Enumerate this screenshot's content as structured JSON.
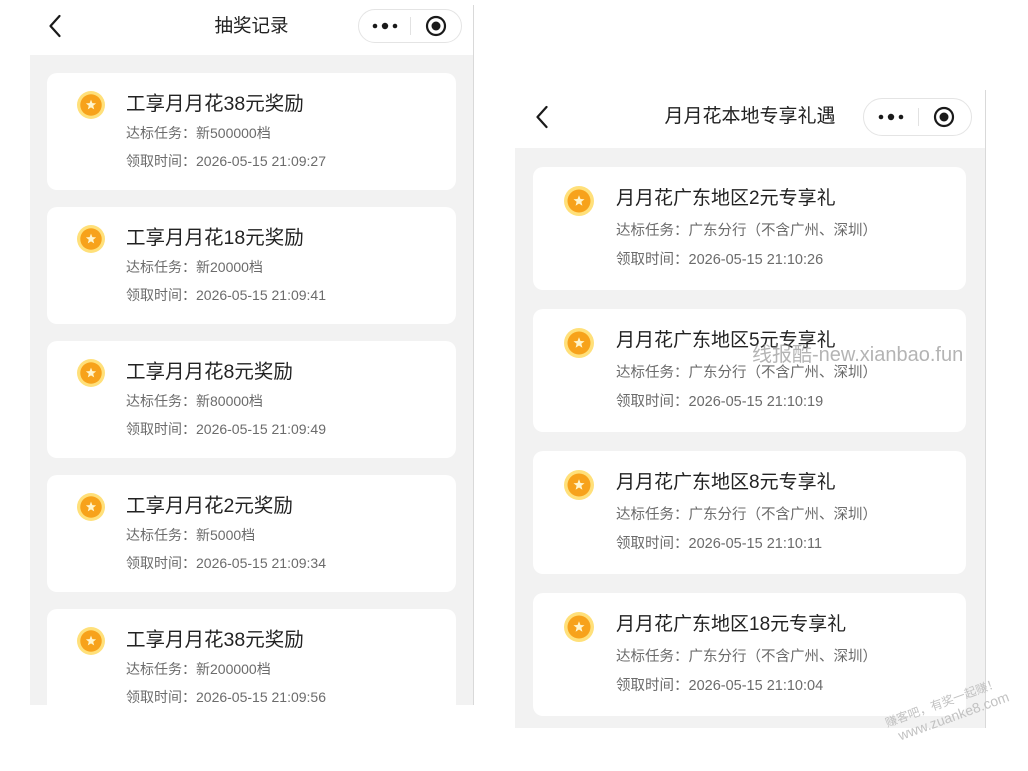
{
  "left_screen": {
    "header": {
      "title": "抽奖记录",
      "back_icon": "back-chevron-icon",
      "more_icon": "more-dots-icon",
      "close_icon": "target-icon"
    },
    "records": [
      {
        "title": "工享月月花38元奖励",
        "task": "达标任务：新500000档",
        "time": "领取时间：2026-05-15 21:09:27"
      },
      {
        "title": "工享月月花18元奖励",
        "task": "达标任务：新20000档",
        "time": "领取时间：2026-05-15 21:09:41"
      },
      {
        "title": "工享月月花8元奖励",
        "task": "达标任务：新80000档",
        "time": "领取时间：2026-05-15 21:09:49"
      },
      {
        "title": "工享月月花2元奖励",
        "task": "达标任务：新5000档",
        "time": "领取时间：2026-05-15 21:09:34"
      },
      {
        "title": "工享月月花38元奖励",
        "task": "达标任务：新200000档",
        "time": "领取时间：2026-05-15 21:09:56"
      }
    ]
  },
  "right_screen": {
    "header": {
      "title": "月月花本地专享礼遇",
      "back_icon": "back-chevron-icon",
      "more_icon": "more-dots-icon",
      "close_icon": "target-icon"
    },
    "records": [
      {
        "title": "月月花广东地区2元专享礼",
        "task": "达标任务：广东分行（不含广州、深圳）",
        "time": "领取时间：2026-05-15 21:10:26"
      },
      {
        "title": "月月花广东地区5元专享礼",
        "task": "达标任务：广东分行（不含广州、深圳）",
        "time": "领取时间：2026-05-15 21:10:19"
      },
      {
        "title": "月月花广东地区8元专享礼",
        "task": "达标任务：广东分行（不含广州、深圳）",
        "time": "领取时间：2026-05-15 21:10:11"
      },
      {
        "title": "月月花广东地区18元专享礼",
        "task": "达标任务：广东分行（不含广州、深圳）",
        "time": "领取时间：2026-05-15 21:10:04"
      }
    ]
  },
  "record_icon": "coin-star-icon",
  "watermarks": {
    "xianbao": "线报酷-new.xianbao.fun",
    "zuanke_slogan": "赚客吧，有奖一起赚！",
    "zuanke_url": "www.zuanke8.com"
  },
  "colors": {
    "page_background": "#ffffff",
    "list_background": "#f2f2f2",
    "card_background": "#ffffff",
    "title_text": "#222222",
    "secondary_text": "#6b6b6b",
    "coin_ring": "#ffe07a",
    "coin_fill": "#f7a21b",
    "coin_star": "#fff5cc"
  }
}
